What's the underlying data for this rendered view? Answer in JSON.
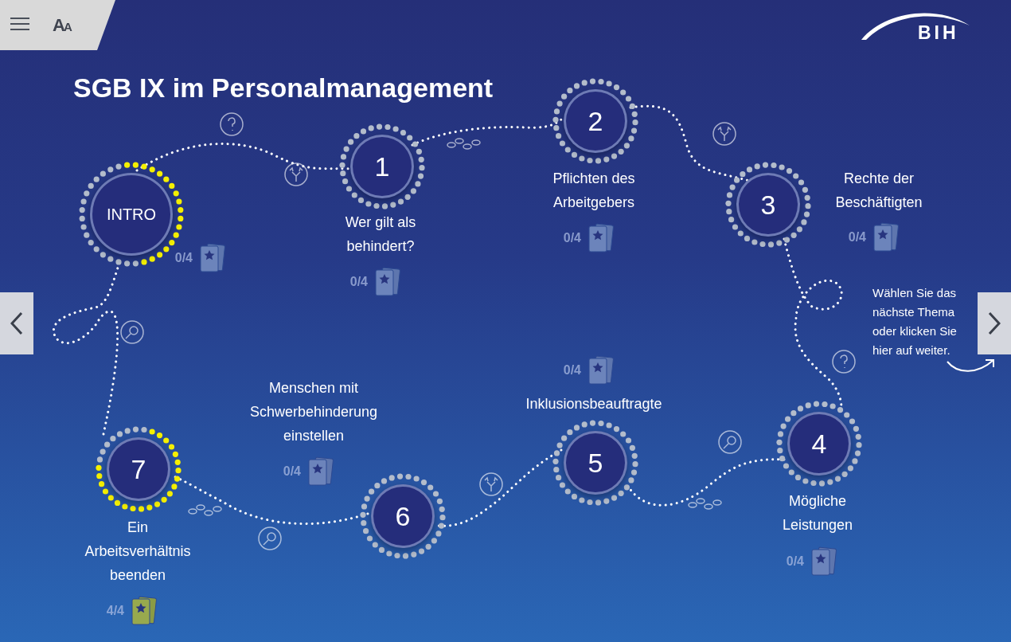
{
  "toolbar": {
    "font_size_button": "AA"
  },
  "logo": {
    "text": "BIH"
  },
  "title": "SGB IX im Personalmanagement",
  "nodes": [
    {
      "label": "INTRO",
      "score": "0/4",
      "complete": false
    },
    {
      "label": "1",
      "title": "Wer gilt als behindert?",
      "score": "0/4",
      "complete": false
    },
    {
      "label": "2",
      "title": "Pflichten des Arbeitgebers",
      "score": "0/4",
      "complete": false
    },
    {
      "label": "3",
      "title": "Rechte der Beschäftigten",
      "score": "0/4",
      "complete": false
    },
    {
      "label": "4",
      "title": "Mögliche Leistungen",
      "score": "0/4",
      "complete": false
    },
    {
      "label": "6",
      "title": "Menschen mit Schwerbehinderung einstellen",
      "score": "0/4",
      "complete": false
    },
    {
      "label": "5",
      "title": "Inklusionsbeauftragte",
      "score": "0/4",
      "complete": false
    },
    {
      "label": "7",
      "title": "Ein Arbeitsverhältnis beenden",
      "score": "4/4",
      "complete": true
    }
  ],
  "hint": "Wählen Sie das nächste Thema oder klicken Sie hier auf weiter."
}
